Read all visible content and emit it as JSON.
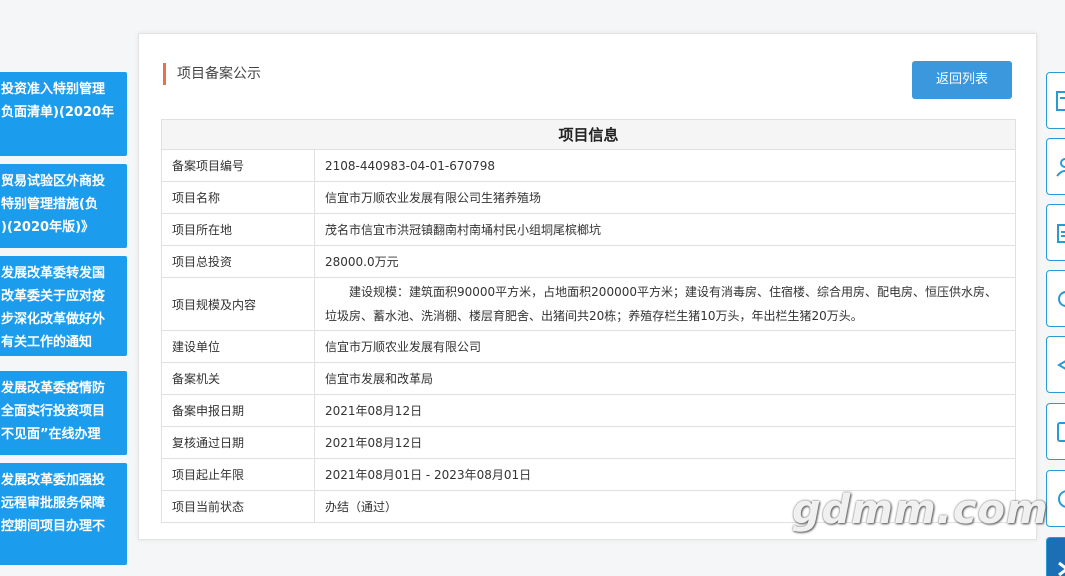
{
  "left_notices": [
    {
      "lines": [
        "投资准入特别管理",
        "负面清单)(2020年"
      ]
    },
    {
      "lines": [
        "贸易试验区外商投",
        "特别管理措施(负",
        ")(2020年版)》"
      ]
    },
    {
      "lines": [
        "发展改革委转发国",
        "改革委关于应对疫",
        "步深化改革做好外",
        "有关工作的通知"
      ]
    },
    {
      "lines": [
        "发展改革委疫情防",
        "全面实行投资项目",
        "不见面”在线办理"
      ]
    },
    {
      "lines": [
        "发展改革委加强投",
        "远程审批服务保障",
        "控期间项目办理不"
      ]
    }
  ],
  "panel": {
    "title": "项目备案公示",
    "back_label": "返回列表"
  },
  "info_table": {
    "heading": "项目信息",
    "rows": [
      {
        "label": "备案项目编号",
        "value": "2108-440983-04-01-670798"
      },
      {
        "label": "项目名称",
        "value": "信宜市万顺农业发展有限公司生猪养殖场"
      },
      {
        "label": "项目所在地",
        "value": "茂名市信宜市洪冠镇翻南村南埇村民小组垌尾槟榔坑"
      },
      {
        "label": "项目总投资",
        "value": "28000.0万元"
      },
      {
        "label": "项目规模及内容",
        "value": "建设规模：建筑面积90000平方米，占地面积200000平方米；建设有消毒房、住宿楼、综合用房、配电房、恒压供水房、垃圾房、蓄水池、洗消棚、楼层育肥舍、出猪间共20栋；养殖存栏生猪10万头，年出栏生猪20万头。"
      },
      {
        "label": "建设单位",
        "value": "信宜市万顺农业发展有限公司"
      },
      {
        "label": "备案机关",
        "value": "信宜市发展和改革局"
      },
      {
        "label": "备案申报日期",
        "value": "2021年08月12日"
      },
      {
        "label": "复核通过日期",
        "value": "2021年08月12日"
      },
      {
        "label": "项目起止年限",
        "value": "2021年08月01日 - 2023年08月01日"
      },
      {
        "label": "项目当前状态",
        "value": "办结（通过）"
      }
    ]
  },
  "side_icons": [
    "document-icon",
    "user-icon",
    "clipboard-icon",
    "search-icon",
    "share-icon",
    "doc-edit-icon",
    "chat-icon",
    "arrow-icon"
  ],
  "watermark": "gdmm.com",
  "colors": {
    "accent_blue": "#1c9cec",
    "button_blue": "#3c98dc",
    "title_bar": "#e8734a"
  }
}
